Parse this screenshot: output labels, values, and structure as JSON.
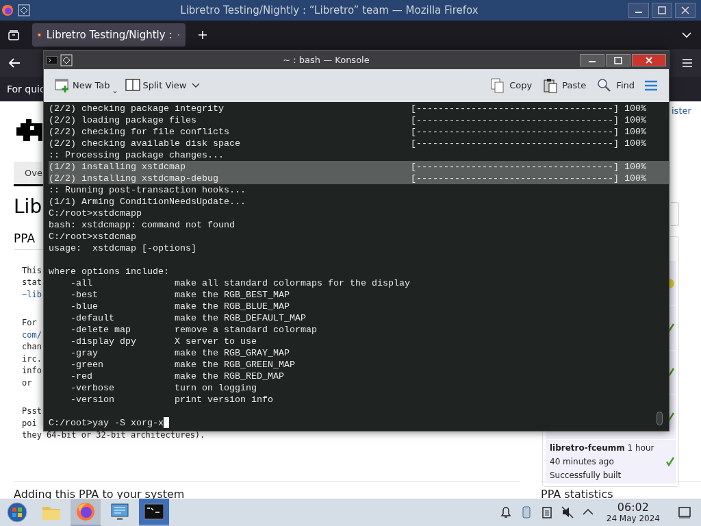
{
  "desktop_title_bar": {
    "title": "Libretro Testing/Nightly : “Libretro” team — Mozilla Firefox"
  },
  "browser": {
    "tabs": [
      {
        "title": "Libretro Testing/Nightly :",
        "selected": true
      }
    ],
    "notice": "For quic",
    "page": {
      "register_link": "ister",
      "tabs": [
        {
          "label": "Ove",
          "selected": true
        }
      ],
      "heading": "Lib",
      "section_heading": "PPA",
      "paragraphs": [
        [
          {
            "text": "This",
            "link": false
          },
          {
            "text": "stat",
            "link": false
          },
          {
            "text": "~lib",
            "link": true
          }
        ],
        [
          {
            "text": "For",
            "link": false
          },
          {
            "text": "com/",
            "link": true
          },
          {
            "text": "chan",
            "link": false
          },
          {
            "text": "irc.",
            "link": false
          },
          {
            "text": "info",
            "link": false
          },
          {
            "text": "or",
            "link": false
          }
        ],
        [
          {
            "text": "Psst",
            "link": false
          },
          {
            "text": "poi",
            "link": false
          },
          {
            "text": "they 64-bit or 32-bit architectures).",
            "link": false
          }
        ]
      ],
      "bottom_headings": [
        "Adding this PPA to your system",
        "PPA statistics"
      ],
      "builds": [
        {
          "kind": "pending"
        },
        {
          "kind": "success"
        },
        {
          "kind": "success"
        },
        {
          "kind": "success"
        },
        {
          "kind": "success",
          "name": "libretro-fceumm",
          "time": "1 hour 40 minutes ago",
          "result": "Successfully built"
        }
      ]
    }
  },
  "konsole": {
    "title": "~ : bash — Konsole",
    "toolbar_left": [
      {
        "kind": "new-tab",
        "label": "New Tab"
      },
      {
        "kind": "split",
        "label": "Split View"
      }
    ],
    "toolbar_right": [
      {
        "kind": "copy",
        "label": "Copy"
      },
      {
        "kind": "paste",
        "label": "Paste"
      },
      {
        "kind": "find",
        "label": "Find"
      }
    ],
    "lines": [
      {
        "kind": "progress",
        "text": "(2/2) checking package integrity",
        "progress": "[------------------------------------] 100%",
        "selected": false
      },
      {
        "kind": "progress",
        "text": "(2/2) loading package files",
        "progress": "[------------------------------------] 100%",
        "selected": false
      },
      {
        "kind": "progress",
        "text": "(2/2) checking for file conflicts",
        "progress": "[------------------------------------] 100%",
        "selected": false
      },
      {
        "kind": "progress",
        "text": "(2/2) checking available disk space",
        "progress": "[------------------------------------] 100%",
        "selected": false
      },
      {
        "kind": "text",
        "text": ":: Processing package changes...",
        "selected": false
      },
      {
        "kind": "progress",
        "text": "(1/2) installing xstdcmap",
        "progress": "[------------------------------------] 100%",
        "selected": true
      },
      {
        "kind": "progress",
        "text": "(2/2) installing xstdcmap-debug",
        "progress": "[------------------------------------] 100%",
        "selected": true
      },
      {
        "kind": "text",
        "text": ":: Running post-transaction hooks...",
        "selected": false
      },
      {
        "kind": "text",
        "text": "(1/1) Arming ConditionNeedsUpdate...",
        "selected": false
      },
      {
        "kind": "text",
        "text": "C:/root>xstdcmapp",
        "selected": false
      },
      {
        "kind": "text",
        "text": "bash: xstdcmapp: command not found",
        "selected": false
      },
      {
        "kind": "text",
        "text": "C:/root>xstdcmap",
        "selected": false
      },
      {
        "kind": "text",
        "text": "usage:  xstdcmap [-options]",
        "selected": false
      },
      {
        "kind": "blank"
      },
      {
        "kind": "text",
        "text": "where options include:",
        "selected": false
      },
      {
        "kind": "option",
        "text": "    -all",
        "description": "make all standard colormaps for the display",
        "selected": false
      },
      {
        "kind": "option",
        "text": "    -best",
        "description": "make the RGB_BEST_MAP",
        "selected": false
      },
      {
        "kind": "option",
        "text": "    -blue",
        "description": "make the RGB_BLUE_MAP",
        "selected": false
      },
      {
        "kind": "option",
        "text": "    -default",
        "description": "make the RGB_DEFAULT_MAP",
        "selected": false
      },
      {
        "kind": "option",
        "text": "    -delete map",
        "description": "remove a standard colormap",
        "selected": false
      },
      {
        "kind": "option",
        "text": "    -display dpy",
        "description": "X server to use",
        "selected": false
      },
      {
        "kind": "option",
        "text": "    -gray",
        "description": "make the RGB_GRAY_MAP",
        "selected": false
      },
      {
        "kind": "option",
        "text": "    -green",
        "description": "make the RGB_GREEN_MAP",
        "selected": false
      },
      {
        "kind": "option",
        "text": "    -red",
        "description": "make the RGB_RED_MAP",
        "selected": false
      },
      {
        "kind": "option",
        "text": "    -verbose",
        "description": "turn on logging",
        "selected": false
      },
      {
        "kind": "option",
        "text": "    -version",
        "description": "print version info",
        "selected": false
      },
      {
        "kind": "blank"
      }
    ],
    "prompt": "C:/root>yay -S xorg-x"
  },
  "taskbar": {
    "apps": [
      {
        "kind": "start",
        "running": false,
        "selected": false
      },
      {
        "kind": "files",
        "running": false,
        "selected": false
      },
      {
        "kind": "firefox",
        "running": true,
        "selected": false
      },
      {
        "kind": "monitor",
        "running": false,
        "selected": false
      },
      {
        "kind": "terminal",
        "running": true,
        "selected": true
      }
    ],
    "tray": [
      {
        "kind": "bell"
      },
      {
        "kind": "phone"
      },
      {
        "kind": "clipboard"
      },
      {
        "kind": "muted"
      },
      {
        "kind": "caret"
      }
    ],
    "time": "06:02",
    "date": "24 May 2024"
  }
}
